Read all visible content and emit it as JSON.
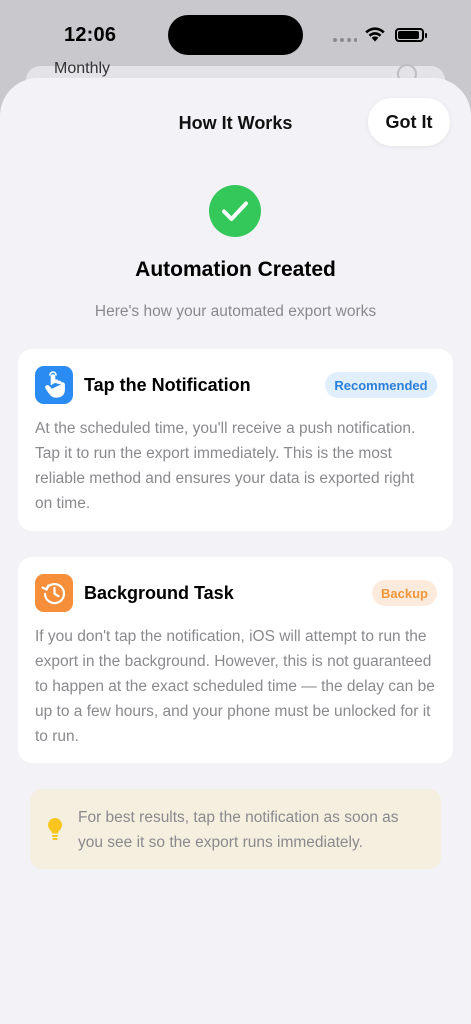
{
  "status_bar": {
    "time": "12:06"
  },
  "background_sheet": {
    "label": "Monthly"
  },
  "sheet": {
    "title": "How It Works",
    "got_it_label": "Got It",
    "headline": "Automation Created",
    "subtitle": "Here's how your automated export works"
  },
  "cards": [
    {
      "title": "Tap the Notification",
      "badge": "Recommended",
      "icon": "hand-tap-icon",
      "body": "At the scheduled time, you'll receive a push notification. Tap it to run the export immediately. This is the most reliable method and ensures your data is exported right on time."
    },
    {
      "title": "Background Task",
      "badge": "Backup",
      "icon": "clock-history-icon",
      "body": "If you don't tap the notification, iOS will attempt to run the export in the background. However, this is not guaranteed to happen at the exact scheduled time — the delay can be up to a few hours, and your phone must be unlocked for it to run."
    }
  ],
  "tip": {
    "icon": "lightbulb-icon",
    "text": "For best results, tap the notification as soon as you see it so the export runs immediately."
  },
  "colors": {
    "success": "#34c759",
    "accent_blue": "#2a8cf2",
    "accent_orange": "#f68e3a",
    "tip_bg": "#f4efde",
    "sheet_bg": "#f2f2f7"
  }
}
